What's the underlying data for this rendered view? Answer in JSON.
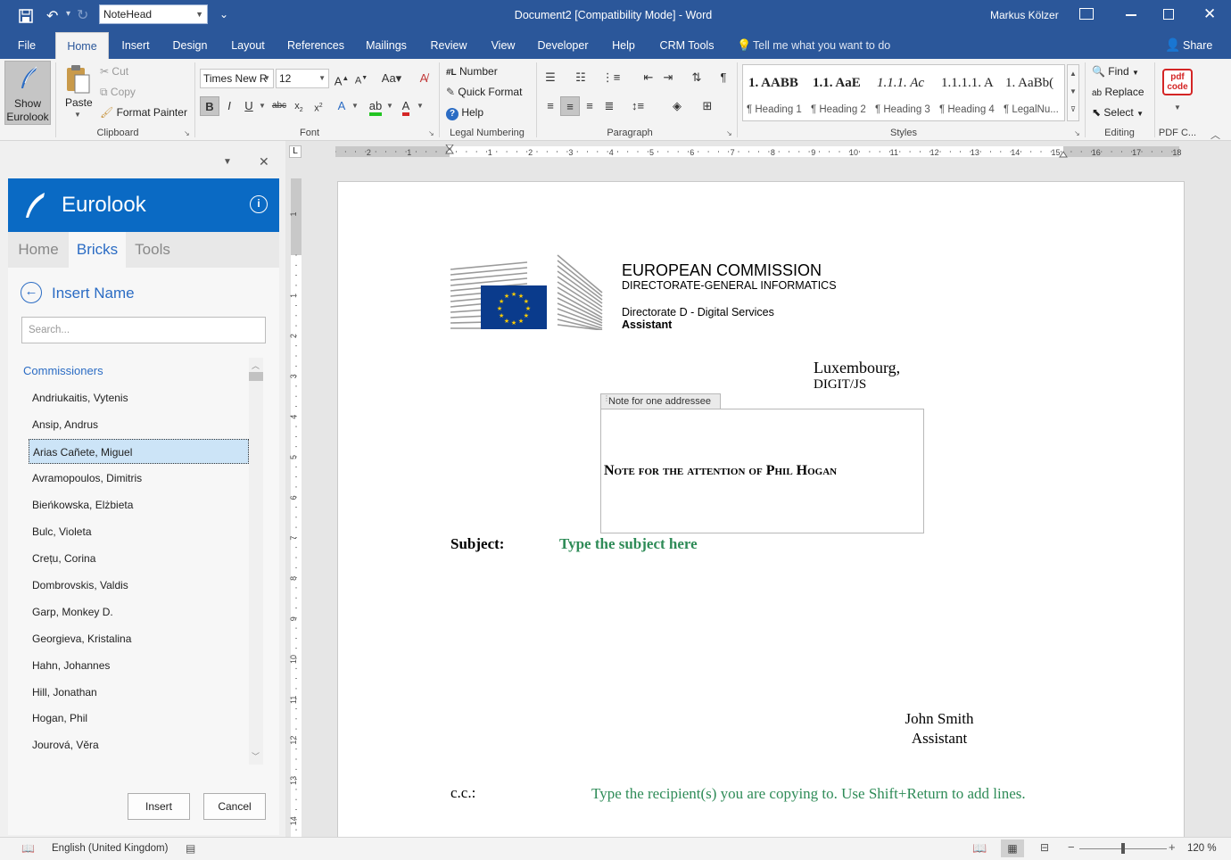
{
  "titlebar": {
    "style_box": "NoteHead",
    "doc_title": "Document2 [Compatibility Mode]  -  Word",
    "user": "Markus Kölzer"
  },
  "tabs": [
    "File",
    "Home",
    "Insert",
    "Design",
    "Layout",
    "References",
    "Mailings",
    "Review",
    "View",
    "Developer",
    "Help",
    "CRM Tools"
  ],
  "tell_me": "Tell me what you want to do",
  "share": "Share",
  "ribbon": {
    "show_eurolook": "Show Eurolook",
    "paste": "Paste",
    "cut": "Cut",
    "copy": "Copy",
    "format_painter": "Format Painter",
    "clipboard": "Clipboard",
    "font_name": "Times New R",
    "font_size": "12",
    "font": "Font",
    "number": "Number",
    "quick_format": "Quick Format",
    "help": "Help",
    "legal_numbering": "Legal Numbering",
    "paragraph": "Paragraph",
    "styles_group": "Styles",
    "styles": [
      {
        "preview": "1.  AABB",
        "name": "¶ Heading 1"
      },
      {
        "preview": "1.1.  AaE",
        "name": "¶ Heading 2"
      },
      {
        "preview": "1.1.1.  Ac",
        "name": "¶ Heading 3"
      },
      {
        "preview": "1.1.1.1.  A",
        "name": "¶ Heading 4"
      },
      {
        "preview": "1.  AaBb(",
        "name": "¶ LegalNu..."
      }
    ],
    "find": "Find",
    "replace": "Replace",
    "select": "Select",
    "editing": "Editing",
    "pdf": "PDF C...",
    "pdf_icon_text": "pdf code"
  },
  "pane": {
    "brand": "Eurolook",
    "tabs": [
      "Home",
      "Bricks",
      "Tools"
    ],
    "heading": "Insert Name",
    "search_placeholder": "Search...",
    "category": "Commissioners",
    "names": [
      "Andriukaitis, Vytenis",
      "Ansip, Andrus",
      "Arias Cañete, Miguel",
      "Avramopoulos, Dimitris",
      "Bieńkowska, Elżbieta",
      "Bulc, Violeta",
      "Crețu, Corina",
      "Dombrovskis, Valdis",
      "Garp, Monkey D.",
      "Georgieva, Kristalina",
      "Hahn, Johannes",
      "Hill, Jonathan",
      "Hogan, Phil",
      "Jourová, Věra"
    ],
    "selected_index": 2,
    "insert": "Insert",
    "cancel": "Cancel"
  },
  "document": {
    "org": "EUROPEAN COMMISSION",
    "dg": "DIRECTORATE-GENERAL INFORMATICS",
    "directorate": "Directorate D - Digital Services",
    "role": "Assistant",
    "place": "Luxembourg,",
    "ref": "DIGIT/JS",
    "cc_title": "Note for one addressee",
    "note": "Note for the attention of Phil Hogan",
    "subject_label": "Subject:",
    "subject_value": "Type the subject here",
    "sign_name": "John Smith",
    "sign_role": "Assistant",
    "cc_label": "c.c.:",
    "cc_value": "Type the recipient(s) you are copying to. Use Shift+Return to add lines."
  },
  "status": {
    "language": "English (United Kingdom)",
    "zoom": "120 %"
  },
  "ruler_numbers": [
    "2",
    "1",
    "1",
    "2",
    "3",
    "4",
    "5",
    "6",
    "7",
    "8",
    "9",
    "10",
    "11",
    "12",
    "13",
    "14",
    "15",
    "16",
    "17",
    "18"
  ],
  "vruler_numbers": [
    "1",
    "1",
    "2",
    "3",
    "4",
    "5",
    "6",
    "7",
    "8",
    "9",
    "10",
    "11",
    "12",
    "13",
    "14"
  ],
  "colors": {
    "accent": "#2b579a",
    "pane_header": "#0a6ac4",
    "green_placeholder": "#2e8b57"
  }
}
